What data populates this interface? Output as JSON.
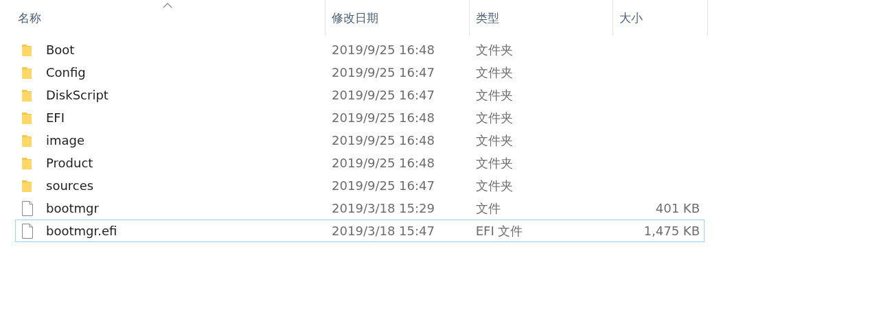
{
  "columns": [
    {
      "label": "名称",
      "sorted": true
    },
    {
      "label": "修改日期",
      "sorted": false
    },
    {
      "label": "类型",
      "sorted": false
    },
    {
      "label": "大小",
      "sorted": false
    }
  ],
  "rows": [
    {
      "kind": "folder",
      "name": "Boot",
      "modified": "2019/9/25 16:48",
      "type": "文件夹",
      "focused": false
    },
    {
      "kind": "folder",
      "name": "Config",
      "modified": "2019/9/25 16:47",
      "type": "文件夹",
      "focused": false
    },
    {
      "kind": "folder",
      "name": "DiskScript",
      "modified": "2019/9/25 16:47",
      "type": "文件夹",
      "focused": false
    },
    {
      "kind": "folder",
      "name": "EFI",
      "modified": "2019/9/25 16:48",
      "type": "文件夹",
      "focused": false
    },
    {
      "kind": "folder",
      "name": "image",
      "modified": "2019/9/25 16:48",
      "type": "文件夹",
      "focused": false
    },
    {
      "kind": "folder",
      "name": "Product",
      "modified": "2019/9/25 16:48",
      "type": "文件夹",
      "focused": false
    },
    {
      "kind": "folder",
      "name": "sources",
      "modified": "2019/9/25 16:47",
      "type": "文件夹",
      "focused": false
    },
    {
      "kind": "file",
      "name": "bootmgr",
      "modified": "2019/3/18 15:29",
      "type": "文件",
      "size": "401 KB",
      "focused": false
    },
    {
      "kind": "file",
      "name": "bootmgr.efi",
      "modified": "2019/3/18 15:47",
      "type": "EFI 文件",
      "size": "1,475 KB",
      "focused": true
    }
  ]
}
